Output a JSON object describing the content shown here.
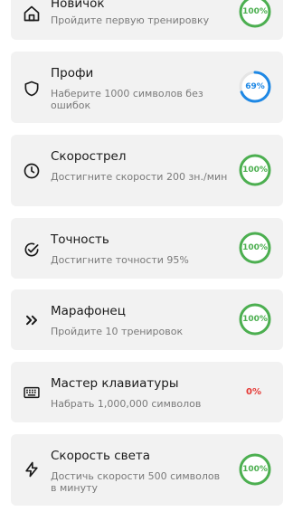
{
  "colors": {
    "card_bg": "#f2f2f2",
    "ring_green": "#4caf50",
    "ring_blue": "#1e88e5",
    "ring_track": "#e5e5e5",
    "zero_red": "#e53935"
  },
  "achievements": [
    {
      "title": "Новичок",
      "description": "Пройдите первую тренировку",
      "icon": "home-icon",
      "progress_label": "100%",
      "progress": 1.0
    },
    {
      "title": "Профи",
      "description": "Наберите 1000 символов без ошибок",
      "icon": "shield-icon",
      "progress_label": "69%",
      "progress": 0.69
    },
    {
      "title": "Скорострел",
      "description": "Достигните скорости 200 зн./мин",
      "icon": "clock-icon",
      "progress_label": "100%",
      "progress": 1.0
    },
    {
      "title": "Точность",
      "description": "Достигните точности 95%",
      "icon": "check-circle-icon",
      "progress_label": "100%",
      "progress": 1.0
    },
    {
      "title": "Марафонец",
      "description": "Пройдите 10 тренировок",
      "icon": "double-chevron-right-icon",
      "progress_label": "100%",
      "progress": 1.0
    },
    {
      "title": "Мастер клавиатуры",
      "description": "Набрать 1,000,000 символов",
      "icon": "keyboard-icon",
      "progress_label": "0%",
      "progress": 0.0
    },
    {
      "title": "Скорость света",
      "description": "Достичь скорости 500 символов в минуту",
      "icon": "lightning-icon",
      "progress_label": "100%",
      "progress": 1.0
    }
  ]
}
